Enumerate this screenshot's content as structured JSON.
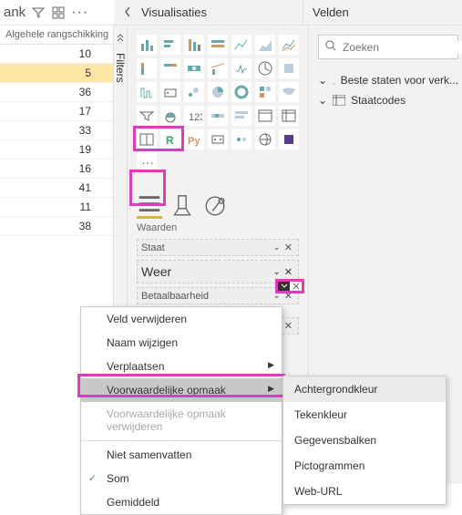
{
  "header": {
    "rank": "ank",
    "vis_title": "Visualisaties",
    "fields_title": "Velden"
  },
  "table": {
    "col_header": "Algehele rangschikking",
    "rows": [
      10,
      5,
      36,
      17,
      33,
      19,
      16,
      41,
      11,
      38
    ]
  },
  "filters_label": "Filters",
  "vis_section": {
    "waarden_label": "Waarden",
    "wells": [
      {
        "label": "Staat"
      },
      {
        "label": "Weer"
      },
      {
        "label": "Betaalbaarheid"
      }
    ]
  },
  "search": {
    "placeholder": "Zoeken"
  },
  "field_list": [
    "Beste staten voor verk...",
    "Staatcodes"
  ],
  "context_menu": [
    {
      "label": "Veld verwijderen"
    },
    {
      "label": "Naam wijzigen"
    },
    {
      "label": "Verplaatsen",
      "arrow": true
    },
    {
      "label": "Voorwaardelijke opmaak",
      "arrow": true,
      "highlight": true
    },
    {
      "label": "Voorwaardelijke opmaak verwijderen",
      "disabled": true
    },
    {
      "sep": true
    },
    {
      "label": "Niet samenvatten"
    },
    {
      "label": "Som",
      "check": true
    },
    {
      "label": "Gemiddeld"
    }
  ],
  "submenu": [
    "Achtergrondkleur",
    "Tekenkleur",
    "Gegevensbalken",
    "Pictogrammen",
    "Web-URL"
  ]
}
